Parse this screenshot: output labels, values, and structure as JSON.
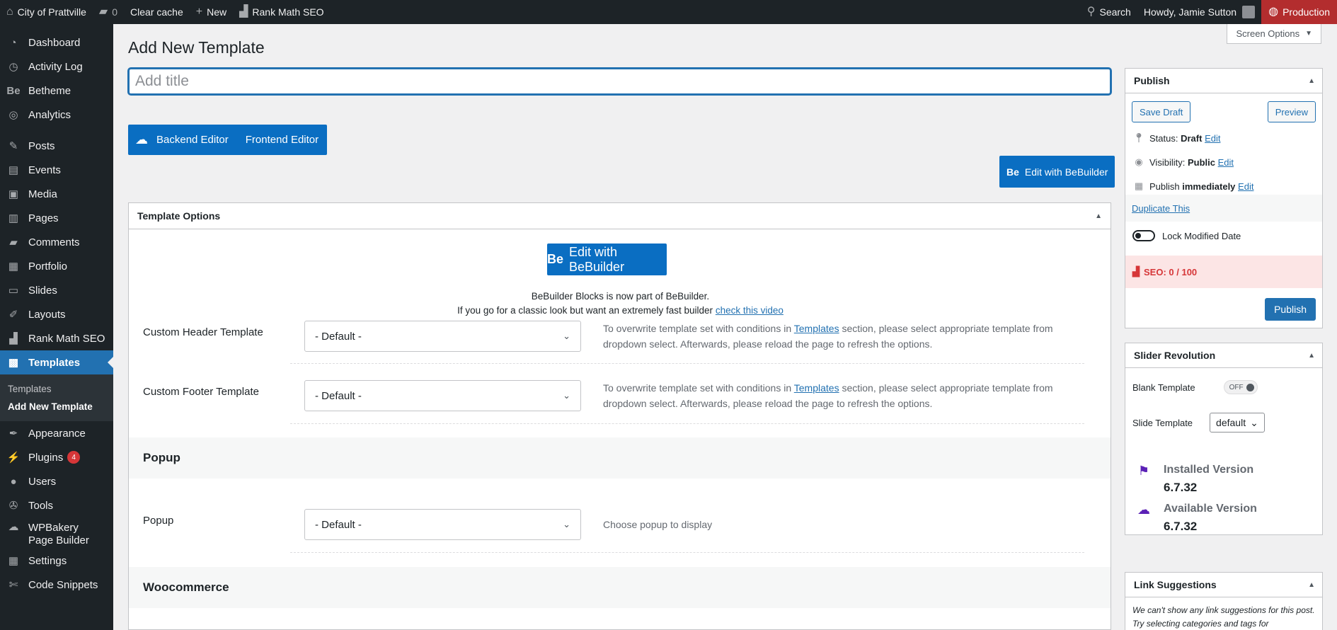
{
  "adminbar": {
    "site_name": "City of Prattville",
    "comments_count": "0",
    "clear_cache": "Clear cache",
    "new": "New",
    "rank_math": "Rank Math SEO",
    "search": "Search",
    "howdy": "Howdy, Jamie Sutton",
    "environment": "Production"
  },
  "sidebar": {
    "items": [
      {
        "label": "Dashboard",
        "icon": "dashboard-icon"
      },
      {
        "label": "Activity Log",
        "icon": "activity-icon"
      },
      {
        "label": "Betheme",
        "icon": "be-icon"
      },
      {
        "label": "Analytics",
        "icon": "analytics-icon"
      },
      {
        "label": "Posts",
        "icon": "pin-icon"
      },
      {
        "label": "Events",
        "icon": "events-icon"
      },
      {
        "label": "Media",
        "icon": "media-icon"
      },
      {
        "label": "Pages",
        "icon": "pages-icon"
      },
      {
        "label": "Comments",
        "icon": "comments-icon"
      },
      {
        "label": "Portfolio",
        "icon": "portfolio-icon"
      },
      {
        "label": "Slides",
        "icon": "slides-icon"
      },
      {
        "label": "Layouts",
        "icon": "layouts-icon"
      },
      {
        "label": "Rank Math SEO",
        "icon": "rankmath-icon"
      },
      {
        "label": "Templates",
        "icon": "templates-icon"
      },
      {
        "label": "Appearance",
        "icon": "appearance-icon"
      },
      {
        "label": "Plugins",
        "icon": "plugins-icon",
        "badge": "4"
      },
      {
        "label": "Users",
        "icon": "users-icon"
      },
      {
        "label": "Tools",
        "icon": "tools-icon"
      },
      {
        "label": "WPBakery Page Builder",
        "icon": "wpbakery-icon"
      },
      {
        "label": "Settings",
        "icon": "settings-icon"
      },
      {
        "label": "Code Snippets",
        "icon": "snippets-icon"
      }
    ],
    "submenu": [
      "Templates",
      "Add New Template"
    ]
  },
  "main": {
    "screen_options": "Screen Options",
    "page_title": "Add New Template",
    "title_placeholder": "Add title",
    "backend_editor": "Backend Editor",
    "frontend_editor": "Frontend Editor",
    "edit_bebuilder": "Edit with BeBuilder",
    "be_mark": "Be"
  },
  "template_options": {
    "title": "Template Options",
    "bb_button": "Edit with BeBuilder",
    "note_line1": "BeBuilder Blocks is now part of BeBuilder.",
    "note_line2": "If you go for a classic look but want an extremely fast builder",
    "note_link": "check this video",
    "rows": [
      {
        "label": "Custom Header Template",
        "value": "- Default -",
        "desc_pre": "To overwrite template set with conditions in ",
        "desc_link": "Templates",
        "desc_post": " section, please select appropriate template from dropdown select. Afterwards, please reload the page to refresh the options."
      },
      {
        "label": "Custom Footer Template",
        "value": "- Default -",
        "desc_pre": "To overwrite template set with conditions in ",
        "desc_link": "Templates",
        "desc_post": " section, please select appropriate template from dropdown select. Afterwards, please reload the page to refresh the options."
      }
    ],
    "popup_section": "Popup",
    "popup_row": {
      "label": "Popup",
      "value": "- Default -",
      "desc": "Choose popup to display"
    },
    "woo_section": "Woocommerce"
  },
  "publish": {
    "title": "Publish",
    "save_draft": "Save Draft",
    "preview": "Preview",
    "status_label": "Status:",
    "status_value": "Draft",
    "visibility_label": "Visibility:",
    "visibility_value": "Public",
    "publish_label": "Publish",
    "publish_value": "immediately",
    "edit": "Edit",
    "duplicate": "Duplicate This",
    "lock_modified": "Lock Modified Date",
    "seo": "SEO: 0 / 100",
    "publish_button": "Publish"
  },
  "slider_revolution": {
    "title": "Slider Revolution",
    "blank_template": "Blank Template",
    "off": "OFF",
    "slide_template": "Slide Template",
    "slide_value": "default",
    "installed_label": "Installed Version",
    "installed_value": "6.7.32",
    "available_label": "Available Version",
    "available_value": "6.7.32"
  },
  "link_suggestions": {
    "title": "Link Suggestions",
    "text": "We can't show any link suggestions for this post. Try selecting categories and tags for"
  },
  "colors": {
    "accent": "#2271b1",
    "bebuilder": "#0a6ec2",
    "adminbar": "#1d2327",
    "production": "#b32d2e"
  }
}
